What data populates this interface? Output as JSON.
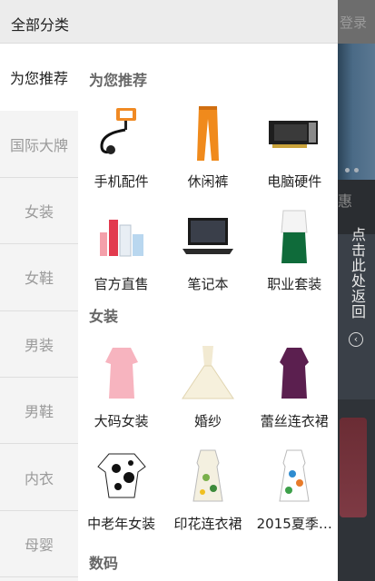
{
  "background_app": {
    "login_label": "登录",
    "partial_char": "惠"
  },
  "return_tab": {
    "label": "点击此处返回"
  },
  "drawer": {
    "title": "全部分类"
  },
  "categories": [
    {
      "label": "为您推荐",
      "active": true
    },
    {
      "label": "国际大牌"
    },
    {
      "label": "女装"
    },
    {
      "label": "女鞋"
    },
    {
      "label": "男装"
    },
    {
      "label": "男鞋"
    },
    {
      "label": "内衣"
    },
    {
      "label": "母婴"
    }
  ],
  "sections": [
    {
      "title": "为您推荐",
      "items": [
        {
          "label": "手机配件",
          "icon": "phone-holder-icon"
        },
        {
          "label": "休闲裤",
          "icon": "pants-icon"
        },
        {
          "label": "电脑硬件",
          "icon": "graphics-card-icon"
        },
        {
          "label": "官方直售",
          "icon": "cosmetics-icon"
        },
        {
          "label": "笔记本",
          "icon": "laptop-icon"
        },
        {
          "label": "职业套装",
          "icon": "suit-icon"
        }
      ]
    },
    {
      "title": "女装",
      "items": [
        {
          "label": "大码女装",
          "icon": "pink-dress-icon"
        },
        {
          "label": "婚纱",
          "icon": "wedding-dress-icon"
        },
        {
          "label": "蕾丝连衣裙",
          "icon": "lace-dress-icon"
        },
        {
          "label": "中老年女装",
          "icon": "floral-blouse-icon"
        },
        {
          "label": "印花连衣裙",
          "icon": "print-dress-icon"
        },
        {
          "label": "2015夏季…",
          "icon": "summer-dress-icon"
        }
      ]
    },
    {
      "title": "数码",
      "items": []
    }
  ]
}
